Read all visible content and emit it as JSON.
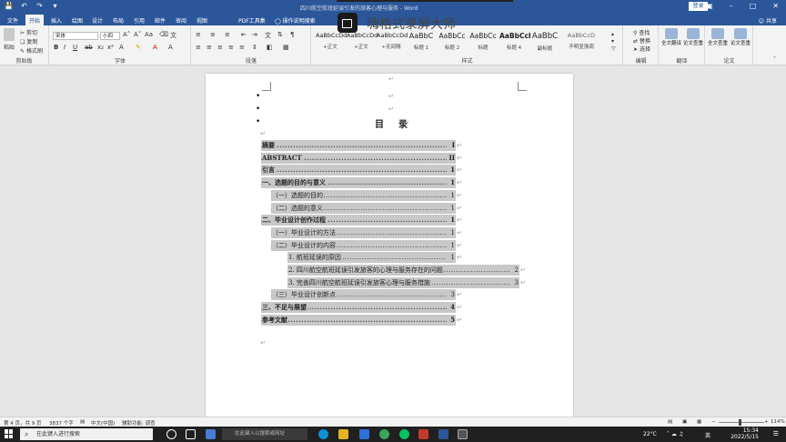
{
  "app": {
    "doc_title": "四川航空航班延误引发的旅客心理与服务 - Word",
    "login_label": "登录",
    "share_label": "共享",
    "qat": [
      "save-icon",
      "undo-icon",
      "redo-icon",
      "customize-icon"
    ],
    "window_buttons": [
      "ribbon-options-icon",
      "minimize-icon",
      "maximize-icon",
      "close-icon"
    ]
  },
  "overlay": {
    "recorder_text": "嗨格式录屏大师"
  },
  "tabs": [
    "文件",
    "开始",
    "插入",
    "绘图",
    "设计",
    "布局",
    "引用",
    "邮件",
    "审阅",
    "视图",
    "PDF工具集",
    "操作说明搜索"
  ],
  "active_tab_index": 1,
  "ribbon": {
    "clipboard": {
      "label": "剪贴板",
      "paste": "粘贴",
      "cut": "剪切",
      "copy": "复制",
      "format_painter": "格式刷"
    },
    "font": {
      "label": "字体",
      "font_name": "宋体",
      "font_size": "小四"
    },
    "paragraph": {
      "label": "段落"
    },
    "styles": {
      "label": "样式",
      "items": [
        {
          "preview": "AaBbCcDd",
          "name": "+正文"
        },
        {
          "preview": "AaBbCcDd",
          "name": "+正文"
        },
        {
          "preview": "AaBbCcDd",
          "name": "+无间隔"
        },
        {
          "preview": "AaBbC",
          "name": "标题 1"
        },
        {
          "preview": "AaBbCc",
          "name": "标题 2"
        },
        {
          "preview": "AaBbCc",
          "name": "标题"
        },
        {
          "preview": "AaBbCcI",
          "name": "标题 4"
        },
        {
          "preview": "AaBbC",
          "name": "副标题"
        },
        {
          "preview": "AaBbCcD",
          "name": "不明显强调"
        }
      ]
    },
    "editing": {
      "label": "编辑",
      "find": "查找",
      "replace": "替换",
      "select": "选择"
    },
    "translate": {
      "label": "翻译",
      "btn1": "全文翻译",
      "btn2": "论文查重"
    },
    "paper": {
      "label": "论文",
      "btn1": "全文查重",
      "btn2": "论文查重"
    }
  },
  "document": {
    "toc_title": "目　录",
    "toc": [
      {
        "title": "摘要",
        "page": "I",
        "bold": true,
        "indent": 0
      },
      {
        "title": "ABSTRACT",
        "page": "II",
        "bold": true,
        "indent": 0
      },
      {
        "title": "引言",
        "page": "1",
        "bold": true,
        "indent": 0
      },
      {
        "title": "一、选题的目的与意义",
        "page": "1",
        "bold": true,
        "indent": 0
      },
      {
        "title": "（一）选题的目的",
        "page": "1",
        "bold": false,
        "indent": 1
      },
      {
        "title": "（二）选题的意义",
        "page": "1",
        "bold": false,
        "indent": 1
      },
      {
        "title": "二、毕业设计创作过程",
        "page": "1",
        "bold": true,
        "indent": 0
      },
      {
        "title": "（一）毕业设计的方法",
        "page": "1",
        "bold": false,
        "indent": 1
      },
      {
        "title": "（二）毕业设计的内容",
        "page": "1",
        "bold": false,
        "indent": 1
      },
      {
        "title": "1. 航班延误的原因",
        "page": "1",
        "bold": false,
        "indent": 2
      },
      {
        "title": "2. 四川航空航班延误引发旅客的心理与服务存在的问题",
        "page": "2",
        "bold": false,
        "indent": 2
      },
      {
        "title": "3. 完善四川航空航班延误引发旅客心理与服务措施",
        "page": "3",
        "bold": false,
        "indent": 2
      },
      {
        "title": "（三）毕业设计创新点",
        "page": "3",
        "bold": false,
        "indent": 1
      },
      {
        "title": "三、不足与展望",
        "page": "4",
        "bold": true,
        "indent": 0
      },
      {
        "title": "参考文献",
        "page": "5",
        "bold": true,
        "indent": 0
      }
    ]
  },
  "status": {
    "page": "第 4 页，共 9 页",
    "words": "3837 个字",
    "lang": "中文(中国)",
    "accessibility": "辅助功能: 调查",
    "zoom": "114%"
  },
  "taskbar": {
    "search_placeholder": "在此键入进行搜索",
    "url_placeholder": "在此键入以搜索或网址",
    "weather": "22°C",
    "time": "15:34",
    "date": "2022/5/15",
    "ime": "英"
  }
}
